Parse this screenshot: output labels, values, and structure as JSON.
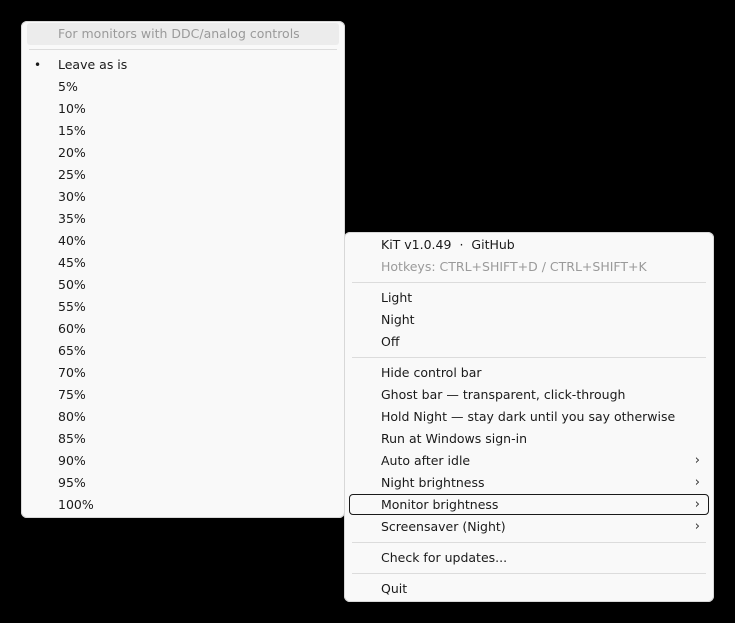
{
  "submenu": {
    "header": "For monitors with DDC/analog controls",
    "items": [
      {
        "label": "Leave as is",
        "selected": true
      },
      {
        "label": "5%"
      },
      {
        "label": "10%"
      },
      {
        "label": "15%"
      },
      {
        "label": "20%"
      },
      {
        "label": "25%"
      },
      {
        "label": "30%"
      },
      {
        "label": "35%"
      },
      {
        "label": "40%"
      },
      {
        "label": "45%"
      },
      {
        "label": "50%"
      },
      {
        "label": "55%"
      },
      {
        "label": "60%"
      },
      {
        "label": "65%"
      },
      {
        "label": "70%"
      },
      {
        "label": "75%"
      },
      {
        "label": "80%"
      },
      {
        "label": "85%"
      },
      {
        "label": "90%"
      },
      {
        "label": "95%"
      },
      {
        "label": "100%"
      }
    ],
    "bullet_glyph": "•"
  },
  "main": {
    "version_label": "KiT v1.0.49",
    "dot": "·",
    "github_label": "GitHub",
    "hotkeys": "Hotkeys: CTRL+SHIFT+D / CTRL+SHIFT+K",
    "modes": [
      "Light",
      "Night",
      "Off"
    ],
    "options": [
      "Hide control bar",
      "Ghost bar — transparent, click-through",
      "Hold Night — stay dark until you say otherwise",
      "Run at Windows sign-in"
    ],
    "submenus": [
      "Auto after idle",
      "Night brightness",
      "Monitor brightness",
      "Screensaver (Night)"
    ],
    "focused_submenu": "Monitor brightness",
    "check_updates": "Check for updates...",
    "quit": "Quit",
    "chevron_glyph": "›"
  }
}
